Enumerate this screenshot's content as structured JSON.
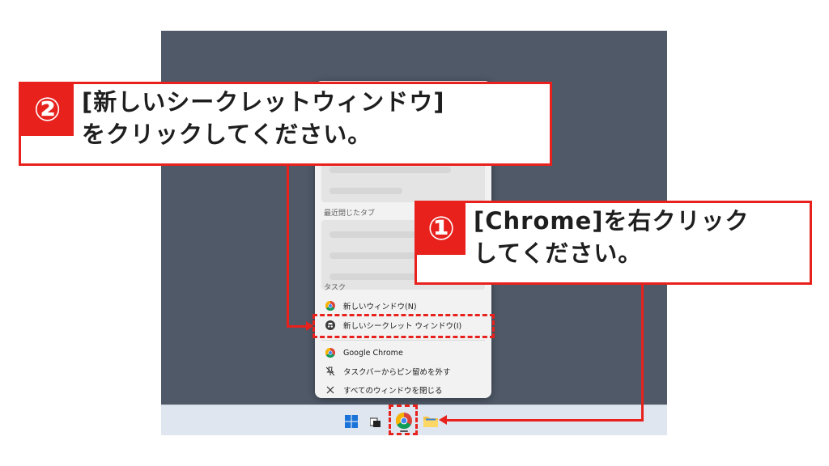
{
  "jumplist": {
    "recent_closed_label": "最近閉じたタブ",
    "tasks_label": "タスク",
    "tasks": [
      {
        "label": "新しいウィンドウ(N)",
        "icon": "chrome-icon"
      },
      {
        "label": "新しいシークレット ウィンドウ(I)",
        "icon": "incognito-icon"
      }
    ],
    "app_items": [
      {
        "label": "Google Chrome",
        "icon": "chrome-icon"
      },
      {
        "label": "タスクバーからピン留めを外す",
        "icon": "unpin-icon"
      },
      {
        "label": "すべてのウィンドウを閉じる",
        "icon": "close-icon"
      }
    ]
  },
  "taskbar": {
    "icons": [
      "windows-start-icon",
      "task-view-icon",
      "chrome-icon",
      "file-explorer-icon"
    ]
  },
  "annotations": {
    "step1": {
      "number": "①",
      "line1": "[Chrome]を右クリック",
      "line2": "してください。"
    },
    "step2": {
      "number": "②",
      "line1": "[新しいシークレットウィンドウ]",
      "line2": "をクリックしてください。"
    }
  },
  "colors": {
    "accent_red": "#e8211d",
    "desktop": "#4f5968",
    "taskbar": "#dfe6ef",
    "menu": "#f2f2f2"
  }
}
